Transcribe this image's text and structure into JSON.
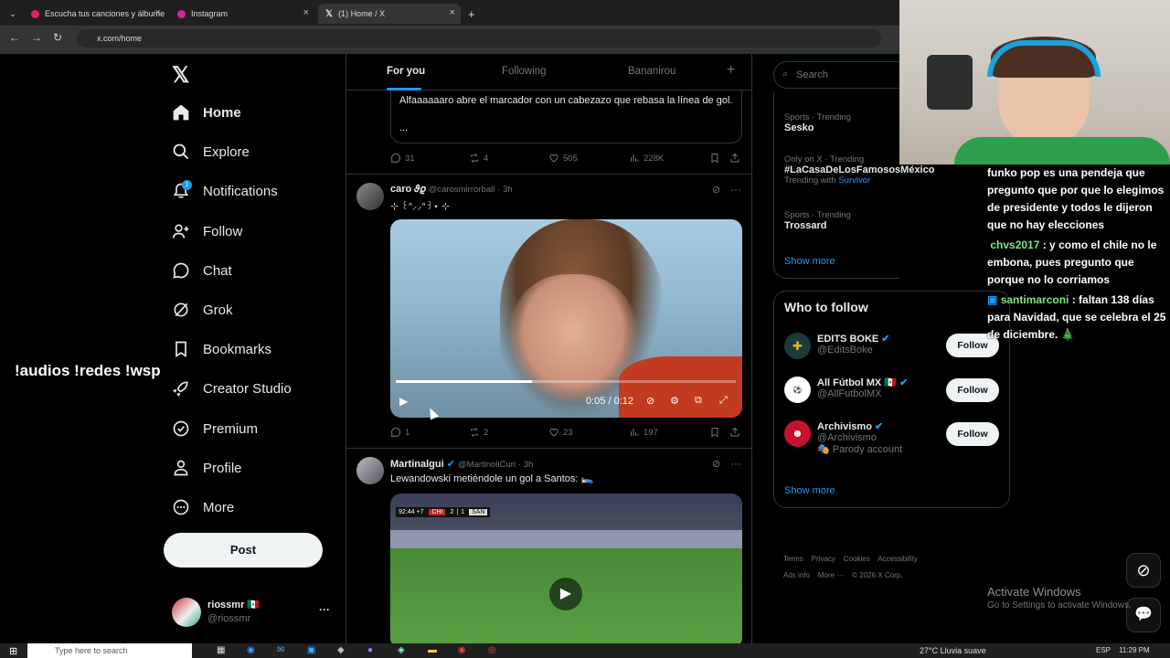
{
  "browser": {
    "tabs": [
      {
        "title": "Escucha tus canciones y álbume",
        "active": false
      },
      {
        "title": "Instagram",
        "active": false
      },
      {
        "title": "(1) Home / X",
        "active": true
      }
    ],
    "url": "x.com/home"
  },
  "nav": {
    "items": [
      {
        "label": "Home",
        "icon": "home-icon"
      },
      {
        "label": "Explore",
        "icon": "search-icon"
      },
      {
        "label": "Notifications",
        "icon": "bell-icon",
        "badge": "1"
      },
      {
        "label": "Follow",
        "icon": "person-add-icon"
      },
      {
        "label": "Chat",
        "icon": "chat-icon"
      },
      {
        "label": "Grok",
        "icon": "grok-icon"
      },
      {
        "label": "Bookmarks",
        "icon": "bookmark-icon"
      },
      {
        "label": "Creator Studio",
        "icon": "rocket-icon"
      },
      {
        "label": "Premium",
        "icon": "verified-icon"
      },
      {
        "label": "Profile",
        "icon": "person-icon"
      },
      {
        "label": "More",
        "icon": "more-circle-icon"
      }
    ],
    "post_label": "Post",
    "account": {
      "name": "riossmr 🇲🇽",
      "handle": "@riossmr"
    }
  },
  "overlay_left": "!audios !redes !wsp",
  "feed": {
    "tabs": [
      "For you",
      "Following",
      "Bananirou"
    ],
    "tweet0": {
      "quote_text": "Alfaaaaaaro abre el marcador con un cabezazo que rebasa la línea de gol.",
      "quote_more": "...",
      "replies": "31",
      "reposts": "4",
      "likes": "505",
      "views": "228K"
    },
    "tweet1": {
      "name": "caro 𝜗𝜚",
      "handle": "@carosmirrorball",
      "time": "· 3h",
      "text": "⊹ ꒰ᐢ⸝⸝ᐢ꒱⋆ ⊹",
      "video_time": "0:05 / 0:12",
      "video_progress": 0.4,
      "replies": "1",
      "reposts": "2",
      "likes": "23",
      "views": "197"
    },
    "tweet2": {
      "name": "Martinalgui",
      "handle": "@MartinoliCuri",
      "time": "· 3h",
      "text": "Lewandowski metiéndole un gol a Santos: 🛌",
      "scoreboard": {
        "clock": "92:44",
        "added": "+7",
        "home": "CHI",
        "home_score": "2",
        "away_score": "1",
        "away": "SAN"
      }
    }
  },
  "right": {
    "search_placeholder": "Search",
    "trends": [
      {
        "meta": "Sports · Trending",
        "title": "Sesko",
        "extra": ""
      },
      {
        "meta": "Only on X · Trending",
        "title": "#LaCasaDeLosFamososMéxico",
        "extra_prefix": "Trending with",
        "extra": "Survivor"
      },
      {
        "meta": "Sports · Trending",
        "title": "Trossard",
        "extra": ""
      }
    ],
    "show_more": "Show more",
    "who_title": "Who to follow",
    "who": [
      {
        "name": "EDITS BOKE",
        "handle": "@EditsBoke",
        "note": ""
      },
      {
        "name": "All Fútbol MX 🇲🇽",
        "handle": "@AllFutbolMX",
        "note": ""
      },
      {
        "name": "Archivismo",
        "handle": "@Archivismo",
        "note": "🎭 Parody account"
      }
    ],
    "follow_label": "Follow",
    "show_more2": "Show more",
    "footer": [
      "Terms",
      "Privacy",
      "Cookies",
      "Accessibility",
      "Ads info",
      "More ···",
      "© 2026 X Corp."
    ]
  },
  "chat": [
    {
      "user": "",
      "text": "funko pop es una pendeja que pregunto que por que lo elegimos de presidente y todos le dijeron que no hay elecciones"
    },
    {
      "user": "chvs2017",
      "text": " : y como el chile no le embona, pues pregunto que porque no lo corriamos"
    },
    {
      "user": "santimarconi",
      "text": " : faltan 138 días para Navidad, que se celebra el 25 de diciembre. 🎄"
    }
  ],
  "watermark": {
    "line1": "Activate Windows",
    "line2": "Go to Settings to activate Windows."
  },
  "taskbar": {
    "search": "Type here to search",
    "weather": "27°C  Lluvia suave",
    "lang": "ESP",
    "time": "11:29 PM"
  }
}
